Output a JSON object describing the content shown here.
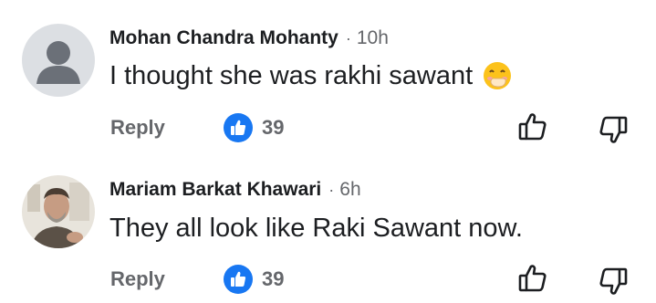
{
  "comments": [
    {
      "author": "Mohan Chandra Mohanty",
      "separator": "·",
      "time": "10h",
      "text": "I thought she was rakhi sawant",
      "emoji": "face-with-hand-over-mouth",
      "reply_label": "Reply",
      "like_count": "39",
      "avatar": "default-avatar"
    },
    {
      "author": "Mariam Barkat Khawari",
      "separator": "·",
      "time": "6h",
      "text": "They all look like Raki Sawant now.",
      "reply_label": "Reply",
      "like_count": "39",
      "avatar": "photo-avatar"
    }
  ],
  "colors": {
    "like_blue": "#1877f2",
    "meta_gray": "#65676b",
    "text": "#1c1e21"
  }
}
